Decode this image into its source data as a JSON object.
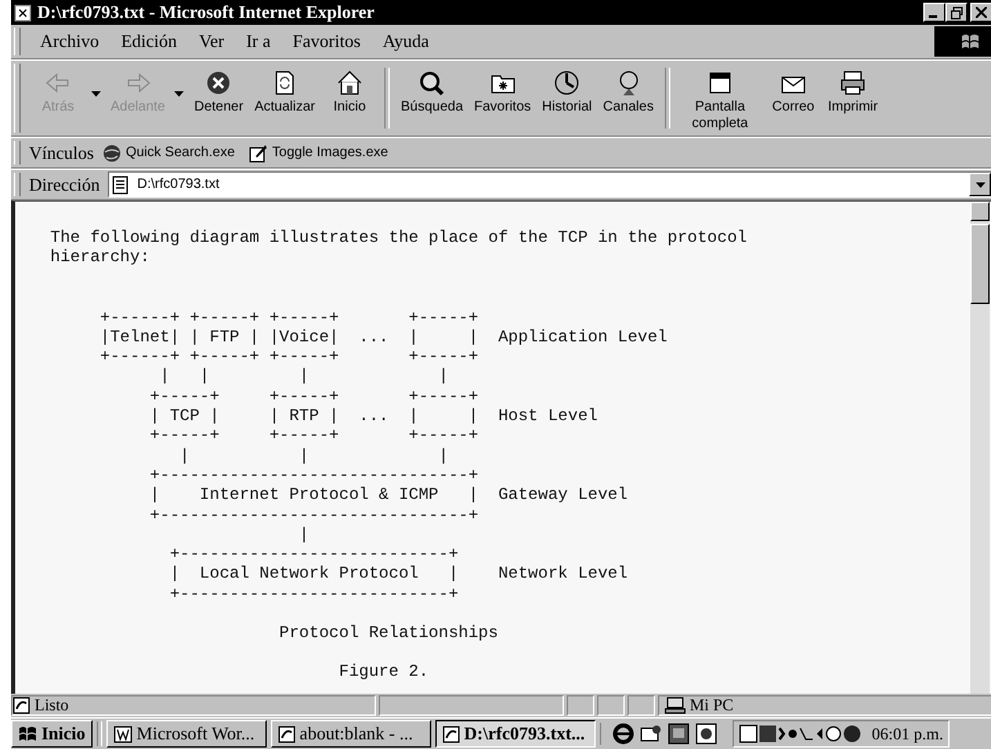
{
  "window": {
    "title": "D:\\rfc0793.txt - Microsoft Internet Explorer"
  },
  "menu": [
    "Archivo",
    "Edición",
    "Ver",
    "Ir a",
    "Favoritos",
    "Ayuda"
  ],
  "toolbar": [
    {
      "label": "Atrás",
      "disabled": true,
      "dropdown": true
    },
    {
      "label": "Adelante",
      "disabled": true,
      "dropdown": true
    },
    {
      "label": "Detener",
      "disabled": false,
      "dropdown": false
    },
    {
      "label": "Actualizar",
      "disabled": false,
      "dropdown": false
    },
    {
      "label": "Inicio",
      "disabled": false,
      "dropdown": false
    },
    {
      "label": "Búsqueda",
      "disabled": false,
      "dropdown": false
    },
    {
      "label": "Favoritos",
      "disabled": false,
      "dropdown": false
    },
    {
      "label": "Historial",
      "disabled": false,
      "dropdown": false
    },
    {
      "label": "Canales",
      "disabled": false,
      "dropdown": false
    },
    {
      "label": "Pantalla completa",
      "disabled": false,
      "dropdown": false
    },
    {
      "label": "Correo",
      "disabled": false,
      "dropdown": false
    },
    {
      "label": "Imprimir",
      "disabled": false,
      "dropdown": false
    }
  ],
  "links_bar": {
    "label": "Vínculos",
    "links": [
      "Quick Search.exe",
      "Toggle Images.exe"
    ]
  },
  "address_bar": {
    "label": "Dirección",
    "value": "D:\\rfc0793.txt"
  },
  "document": {
    "blocks": [
      {
        "lines": [
          "  The following diagram illustrates the place of the TCP in the protocol",
          "  hierarchy:"
        ]
      },
      {
        "lines": [
          "       +------+ +-----+ +-----+       +-----+",
          "       |Telnet| | FTP | |Voice|  ...  |     |  Application Level",
          "       +------+ +-----+ +-----+       +-----+",
          "             |   |         |             |",
          "            +-----+     +-----+       +-----+",
          "            | TCP |     | RTP |  ...  |     |  Host Level",
          "            +-----+     +-----+       +-----+",
          "               |           |             |",
          "            +-------------------------------+",
          "            |    Internet Protocol & ICMP   |  Gateway Level",
          "            +-------------------------------+",
          "                           |",
          "              +---------------------------+",
          "              |  Local Network Protocol   |    Network Level",
          "              +---------------------------+"
        ]
      },
      {
        "lines": [
          "                         Protocol Relationships"
        ]
      },
      {
        "lines": [
          "                               Figure 2."
        ]
      }
    ]
  },
  "status_bar": {
    "text": "Listo",
    "zone": "Mi PC"
  },
  "taskbar": {
    "start": "Inicio",
    "tasks": [
      {
        "label": "Microsoft Wor...",
        "selected": false
      },
      {
        "label": "about:blank - ...",
        "selected": false
      },
      {
        "label": "D:\\rfc0793.txt...",
        "selected": true
      }
    ],
    "clock": "06:01 p.m."
  }
}
